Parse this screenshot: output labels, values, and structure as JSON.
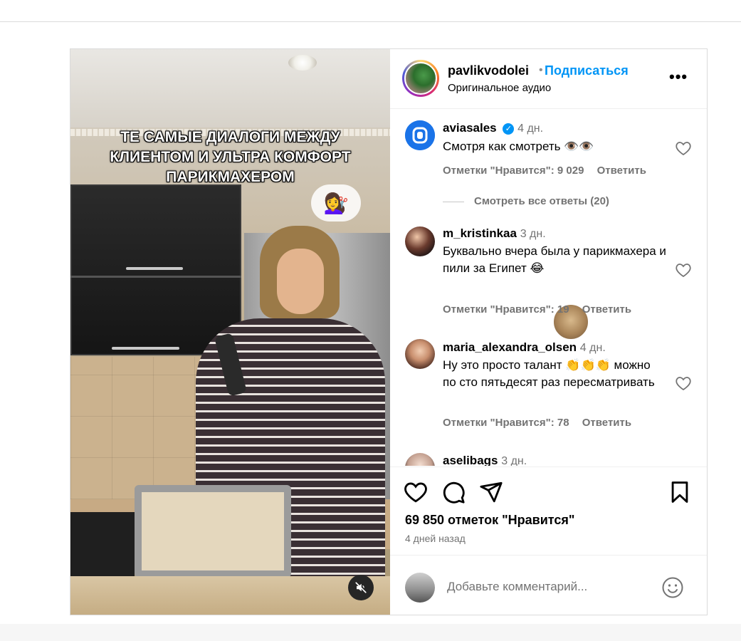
{
  "post": {
    "media": {
      "caption": "ТЕ САМЫЕ ДИАЛОГИ МЕЖДУ\nКЛИЕНТОМ И УЛЬТРА КОМФОРТ\nПАРИКМАХЕРОМ",
      "sticker_emoji": "💇‍♀️",
      "muted": true
    },
    "header": {
      "username": "pavlikvodolei",
      "separator": "•",
      "follow_label": "Подписаться",
      "audio": "Оригинальное аудио",
      "more_label": "•••"
    },
    "comments": [
      {
        "username": "aviasales",
        "verified": true,
        "time": "4 дн.",
        "text": "Смотря как смотреть 👁️👁️",
        "likes_label": "Отметки \"Нравится\": 9 029",
        "reply_label": "Ответить",
        "view_replies": "Смотреть все ответы (20)"
      },
      {
        "username": "m_kristinkaa",
        "time": "3 дн.",
        "text": "Буквально вчера была у парикмахера и пили за Египет 😂",
        "likes_label": "Отметки \"Нравится\": 19",
        "reply_label": "Ответить"
      },
      {
        "username": "maria_alexandra_olsen",
        "time": "4 дн.",
        "text": "Ну это просто талант 👏👏👏 можно по сто пятьдесят раз пересматривать",
        "likes_label": "Отметки \"Нравится\": 78",
        "reply_label": "Ответить"
      },
      {
        "username": "aselibags",
        "time": "3 дн."
      }
    ],
    "likes_count": "69 850 отметок \"Нравится\"",
    "posted_ago": "4 дней назад",
    "comment_placeholder": "Добавьте комментарий...",
    "colors": {
      "accent": "#0095f6",
      "muted_text": "#737373",
      "border": "#dbdbdb"
    }
  }
}
